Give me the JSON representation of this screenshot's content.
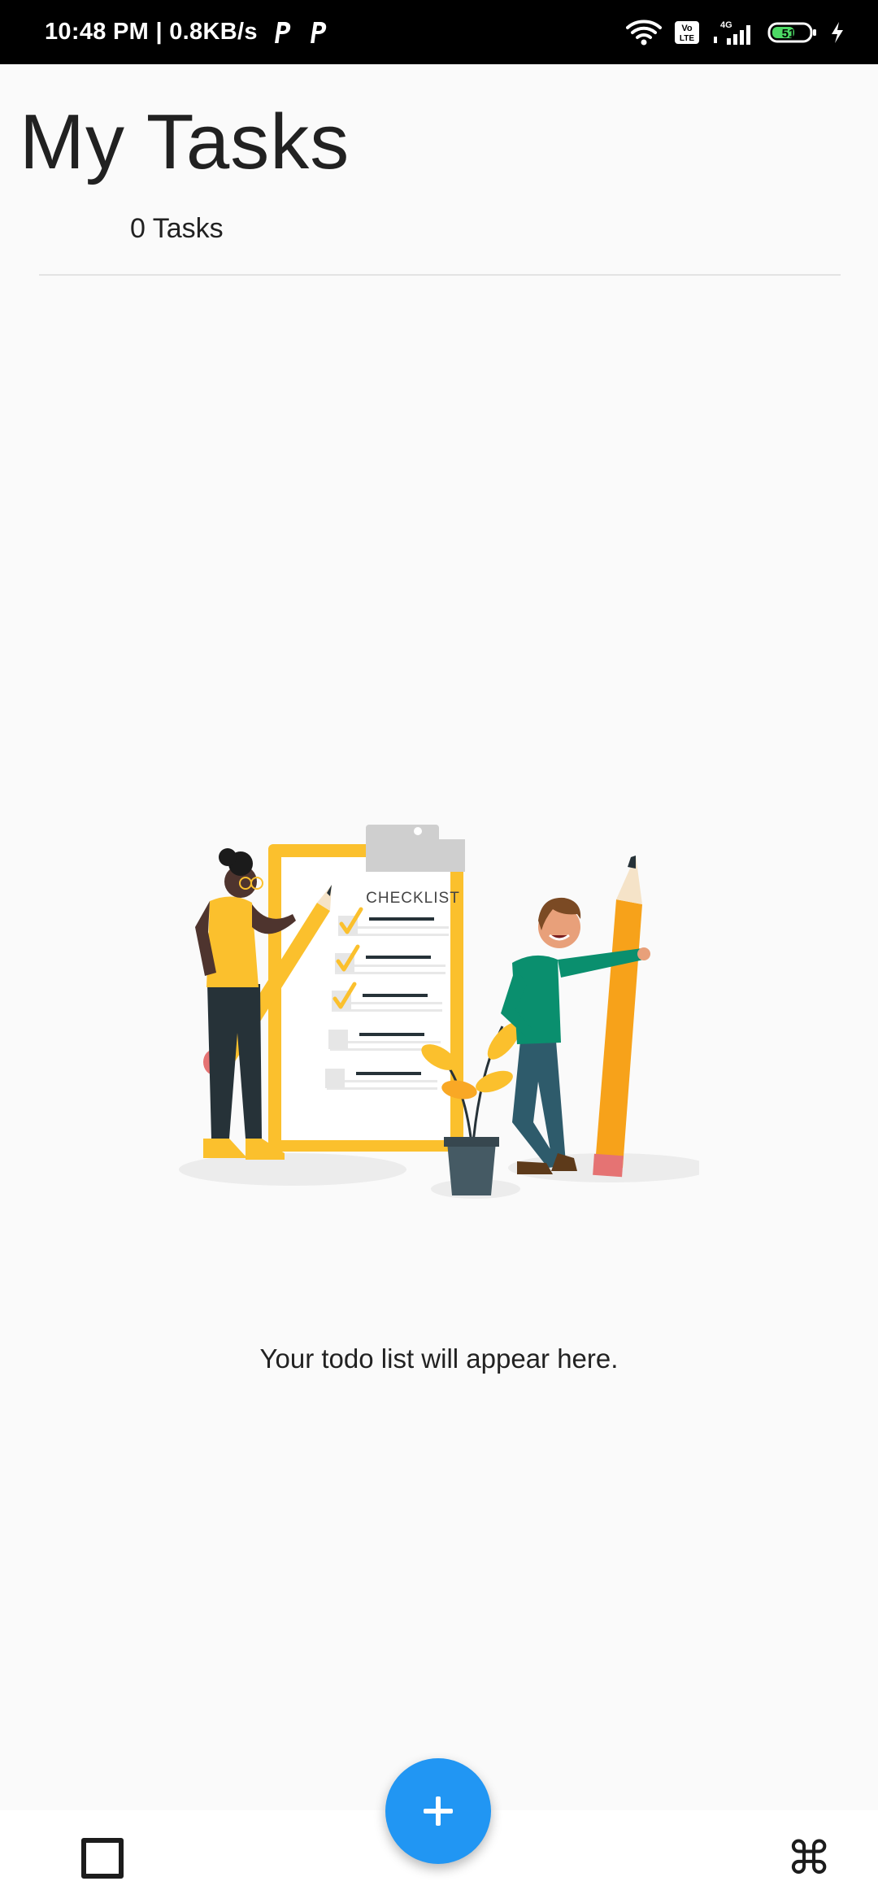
{
  "status_bar": {
    "time_and_speed": "10:48 PM | 0.8KB/s",
    "network_label": "4G",
    "volte_label": "Vo LTE",
    "battery_level": "51"
  },
  "header": {
    "title": "My Tasks",
    "task_count": "0 Tasks"
  },
  "illustration": {
    "clipboard_label": "CHECKLIST"
  },
  "empty_state": {
    "message": "Your todo list will appear here."
  },
  "fab": {
    "icon": "plus-icon",
    "color": "#2196f3"
  },
  "bottom_nav": {
    "left_icon": "square-icon",
    "right_icon": "command-icon",
    "right_glyph": "⌘"
  }
}
